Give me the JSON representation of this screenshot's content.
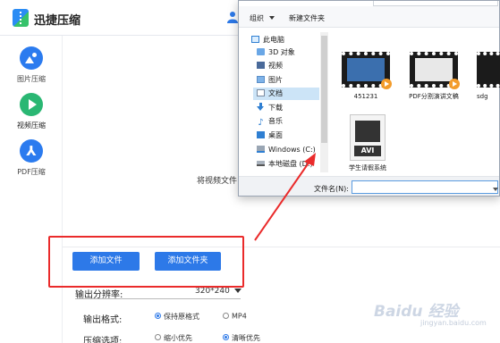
{
  "app": {
    "title": "迅捷压缩"
  },
  "sidebar": {
    "items": [
      {
        "label": "图片压缩",
        "icon": "image-icon"
      },
      {
        "label": "视频压缩",
        "icon": "play-icon"
      },
      {
        "label": "PDF压缩",
        "icon": "pdf-icon"
      }
    ]
  },
  "main": {
    "drop_hint": "将视频文件",
    "add_file_label": "添加文件",
    "add_folder_label": "添加文件夹",
    "resolution_label": "输出分辨率:",
    "resolution_value": "320*240",
    "format_label": "输出格式:",
    "format_options": [
      "保持原格式",
      "MP4"
    ],
    "format_selected": "保持原格式",
    "compress_label": "压缩选项:",
    "compress_options": [
      "缩小优先",
      "清晰优先"
    ],
    "compress_selected": "清晰优先"
  },
  "dialog": {
    "toolbar": {
      "organize": "组织",
      "new_folder": "新建文件夹"
    },
    "tree": [
      {
        "label": "此电脑",
        "icon": "computer-icon"
      },
      {
        "label": "3D 对象",
        "icon": "3d-object-icon"
      },
      {
        "label": "视频",
        "icon": "video-folder-icon"
      },
      {
        "label": "图片",
        "icon": "pictures-folder-icon"
      },
      {
        "label": "文档",
        "icon": "documents-folder-icon",
        "selected": true
      },
      {
        "label": "下载",
        "icon": "download-icon"
      },
      {
        "label": "音乐",
        "icon": "music-icon"
      },
      {
        "label": "桌面",
        "icon": "desktop-icon"
      },
      {
        "label": "Windows (C:)",
        "icon": "windows-drive-icon"
      },
      {
        "label": "本地磁盘 (D:)",
        "icon": "disk-drive-icon"
      }
    ],
    "files": [
      {
        "name": "451231",
        "type": "video"
      },
      {
        "name": "PDF分割演讲文稿",
        "type": "video"
      },
      {
        "name": "sdg",
        "type": "video"
      },
      {
        "name": "学生请假系统",
        "type": "avi"
      }
    ],
    "avi_badge": "AVI",
    "filename_label": "文件名(N):",
    "filename_value": ""
  },
  "colors": {
    "accent": "#2d79e8",
    "annotation_red": "#ea2b2b",
    "video_green": "#2ab773"
  },
  "watermark": {
    "text": "Baidu 经验",
    "sub": "jingyan.baidu.com"
  }
}
